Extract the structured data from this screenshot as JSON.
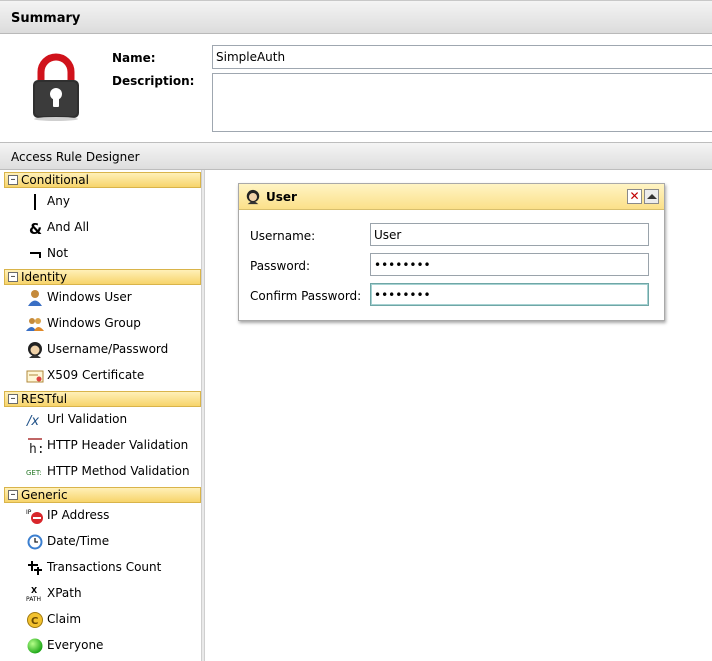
{
  "summary": {
    "title": "Summary",
    "name_label": "Name:",
    "name_value": "SimpleAuth",
    "description_label": "Description:",
    "description_value": ""
  },
  "designer": {
    "title": "Access Rule Designer"
  },
  "toolbox": {
    "groups": [
      {
        "title": "Conditional",
        "items": [
          {
            "label": "Any",
            "icon": "any-bar-icon"
          },
          {
            "label": "And All",
            "icon": "ampersand-icon"
          },
          {
            "label": "Not",
            "icon": "not-icon"
          }
        ]
      },
      {
        "title": "Identity",
        "items": [
          {
            "label": "Windows User",
            "icon": "windows-user-icon"
          },
          {
            "label": "Windows Group",
            "icon": "windows-group-icon"
          },
          {
            "label": "Username/Password",
            "icon": "username-password-icon"
          },
          {
            "label": "X509 Certificate",
            "icon": "certificate-icon"
          }
        ]
      },
      {
        "title": "RESTful",
        "items": [
          {
            "label": "Url Validation",
            "icon": "url-validation-icon"
          },
          {
            "label": "HTTP Header Validation",
            "icon": "http-header-icon"
          },
          {
            "label": "HTTP Method Validation",
            "icon": "http-method-icon"
          }
        ]
      },
      {
        "title": "Generic",
        "items": [
          {
            "label": "IP Address",
            "icon": "ip-address-icon"
          },
          {
            "label": "Date/Time",
            "icon": "clock-icon"
          },
          {
            "label": "Transactions Count",
            "icon": "transactions-icon"
          },
          {
            "label": "XPath",
            "icon": "xpath-icon"
          },
          {
            "label": "Claim",
            "icon": "claim-icon"
          },
          {
            "label": "Everyone",
            "icon": "everyone-icon"
          }
        ]
      }
    ]
  },
  "user_card": {
    "title": "User",
    "close_glyph": "✕",
    "username_label": "Username:",
    "username_value": "User",
    "password_label": "Password:",
    "password_value": "••••••••",
    "confirm_label": "Confirm Password:",
    "confirm_value": "••••••••"
  },
  "colors": {
    "group_header": "#f7d46b",
    "card_header": "#fbe089",
    "close_red": "#c00000"
  }
}
